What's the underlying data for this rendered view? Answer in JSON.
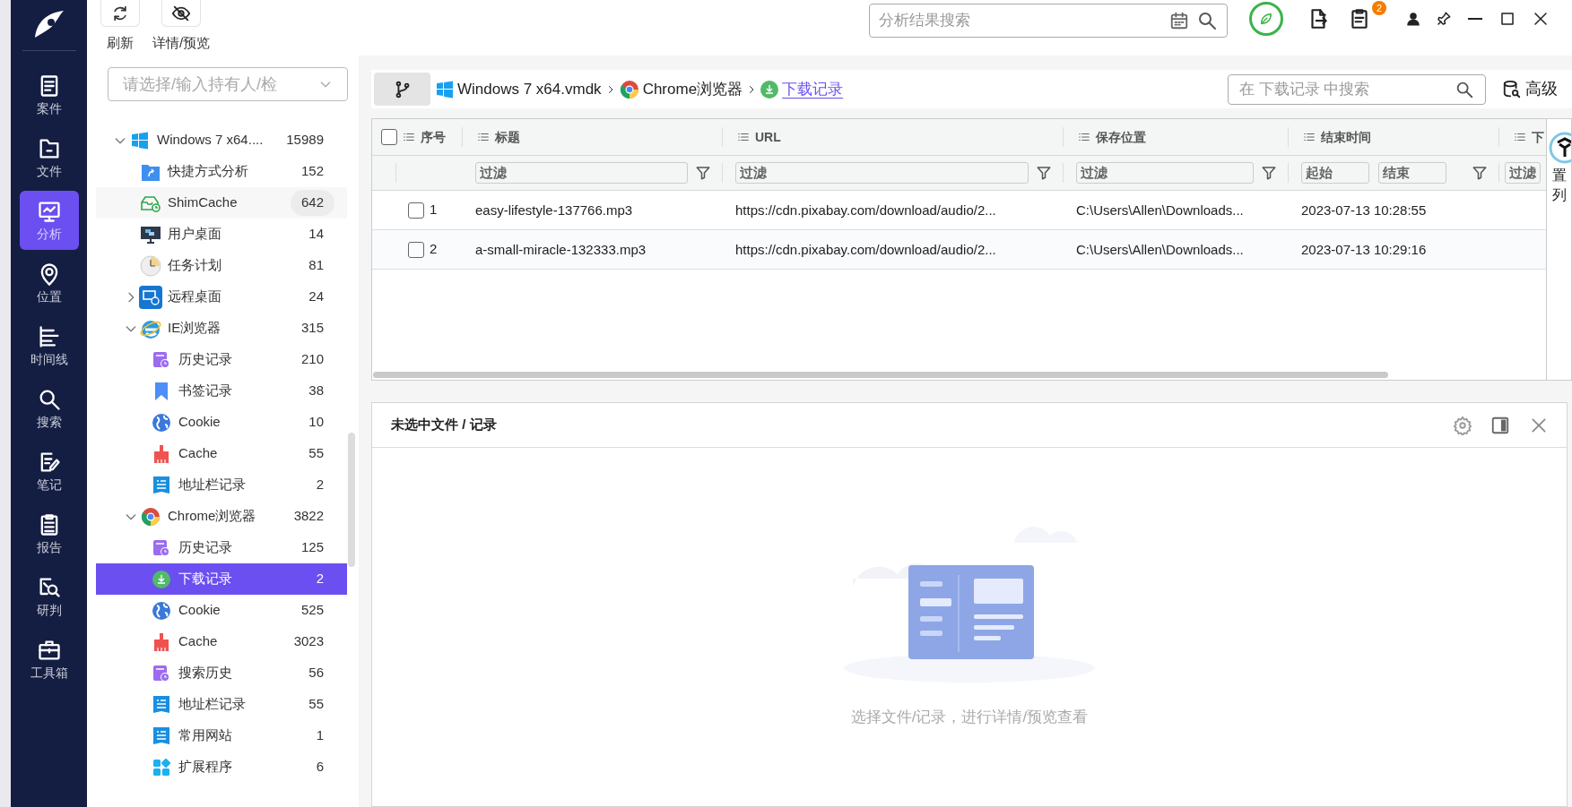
{
  "nav": [
    {
      "label": "案件",
      "kind": "case",
      "selected": false
    },
    {
      "label": "文件",
      "kind": "file",
      "selected": false
    },
    {
      "label": "分析",
      "kind": "analysis",
      "selected": true
    },
    {
      "label": "位置",
      "kind": "location",
      "selected": false
    },
    {
      "label": "时间线",
      "kind": "timeline",
      "selected": false
    },
    {
      "label": "搜索",
      "kind": "search",
      "selected": false
    },
    {
      "label": "笔记",
      "kind": "notes",
      "selected": false
    },
    {
      "label": "报告",
      "kind": "report",
      "selected": false
    },
    {
      "label": "研判",
      "kind": "judge",
      "selected": false
    },
    {
      "label": "工具箱",
      "kind": "toolbox",
      "selected": false
    }
  ],
  "toolbar": [
    {
      "label": "刷新",
      "kind": "refresh"
    },
    {
      "label": "详情/预览",
      "kind": "preview"
    }
  ],
  "search": {
    "placeholder": "分析结果搜索"
  },
  "notification_count": "2",
  "case_selector": {
    "placeholder": "请选择/输入持有人/检"
  },
  "tree": {
    "label": "Windows 7 x64....",
    "count": "15989",
    "kind": "windows",
    "expanded": true,
    "selected": false,
    "hovered": false,
    "children": [
      {
        "label": "快捷方式分析",
        "count": "152",
        "kind": "shortcut",
        "selected": false,
        "hovered": false
      },
      {
        "label": "ShimCache",
        "count": "642",
        "kind": "shimcache",
        "selected": false,
        "hovered": true
      },
      {
        "label": "用户桌面",
        "count": "14",
        "kind": "desktop",
        "selected": false,
        "hovered": false
      },
      {
        "label": "任务计划",
        "count": "81",
        "kind": "schedule",
        "selected": false,
        "hovered": false
      },
      {
        "label": "远程桌面",
        "count": "24",
        "kind": "remote",
        "expanded": false,
        "selected": false,
        "hovered": false
      },
      {
        "label": "IE浏览器",
        "count": "315",
        "kind": "ie",
        "expanded": true,
        "selected": false,
        "hovered": false,
        "children": [
          {
            "label": "历史记录",
            "count": "210",
            "kind": "history",
            "selected": false,
            "hovered": false
          },
          {
            "label": "书签记录",
            "count": "38",
            "kind": "bookmark",
            "selected": false,
            "hovered": false
          },
          {
            "label": "Cookie",
            "count": "10",
            "kind": "cookie",
            "selected": false,
            "hovered": false
          },
          {
            "label": "Cache",
            "count": "55",
            "kind": "cache",
            "selected": false,
            "hovered": false
          },
          {
            "label": "地址栏记录",
            "count": "2",
            "kind": "addressbar",
            "selected": false,
            "hovered": false
          }
        ]
      },
      {
        "label": "Chrome浏览器",
        "count": "3822",
        "kind": "chrome",
        "expanded": true,
        "selected": false,
        "hovered": false,
        "children": [
          {
            "label": "历史记录",
            "count": "125",
            "kind": "history",
            "selected": false,
            "hovered": false
          },
          {
            "label": "下载记录",
            "count": "2",
            "kind": "download",
            "selected": true,
            "hovered": false
          },
          {
            "label": "Cookie",
            "count": "525",
            "kind": "cookie",
            "selected": false,
            "hovered": false
          },
          {
            "label": "Cache",
            "count": "3023",
            "kind": "cache",
            "selected": false,
            "hovered": false
          },
          {
            "label": "搜索历史",
            "count": "56",
            "kind": "history",
            "selected": false,
            "hovered": false
          },
          {
            "label": "地址栏记录",
            "count": "55",
            "kind": "addressbar",
            "selected": false,
            "hovered": false
          },
          {
            "label": "常用网站",
            "count": "1",
            "kind": "addressbar",
            "selected": false,
            "hovered": false
          },
          {
            "label": "扩展程序",
            "count": "6",
            "kind": "extensions",
            "selected": false,
            "hovered": false
          }
        ]
      }
    ]
  },
  "breadcrumb": [
    {
      "label": "Windows 7 x64.vmdk",
      "kind": "windows"
    },
    {
      "label": "Chrome浏览器",
      "kind": "chrome"
    },
    {
      "label": "下载记录",
      "kind": "download"
    }
  ],
  "table_search": {
    "placeholder": "在 下载记录 中搜索"
  },
  "advanced_button": "高级",
  "table": {
    "all_checked": false,
    "columns": [
      {
        "label": "序号"
      },
      {
        "label": "标题",
        "filter_placeholders": [
          "过滤"
        ]
      },
      {
        "label": "URL",
        "filter_placeholders": [
          "过滤"
        ]
      },
      {
        "label": "保存位置",
        "filter_placeholders": [
          "过滤"
        ]
      },
      {
        "label": "结束时间",
        "filter_placeholders": [
          "起始",
          "结束"
        ]
      },
      {
        "label": "下",
        "filter_placeholders": [
          "过滤"
        ]
      }
    ],
    "rows": [
      {
        "checked": false,
        "cells": [
          "1",
          "easy-lifestyle-137766.mp3",
          "https://cdn.pixabay.com/download/audio/2...",
          "C:\\Users\\Allen\\Downloads...",
          "2023-07-13 10:28:55"
        ]
      },
      {
        "checked": false,
        "cells": [
          "2",
          "a-small-miracle-132333.mp3",
          "https://cdn.pixabay.com/download/audio/2...",
          "C:\\Users\\Allen\\Downloads...",
          "2023-07-13 10:29:16"
        ]
      }
    ]
  },
  "column_settings": "置列",
  "detail_panel": {
    "title": "未选中文件 / 记录",
    "empty_text": "选择文件/记录，进行详情/预览查看"
  }
}
